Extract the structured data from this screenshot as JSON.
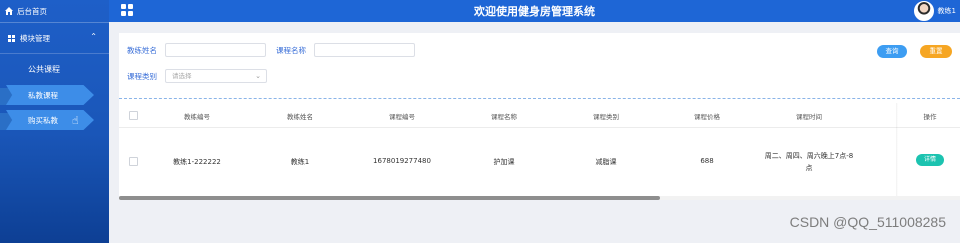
{
  "sidebar": {
    "home_label": "后台首页",
    "group_label": "模块管理",
    "items": [
      {
        "label": "公共课程"
      },
      {
        "label": "私教课程"
      },
      {
        "label": "购买私教"
      }
    ]
  },
  "header": {
    "title": "欢迎使用健身房管理系统",
    "username": "教练1"
  },
  "search": {
    "coach_name_label": "教练姓名",
    "course_name_label": "课程名称",
    "course_type_label": "课程类别",
    "course_type_placeholder": "请选择",
    "search_button": "查询",
    "reset_button": "重置"
  },
  "table": {
    "columns": [
      "教练编号",
      "教练姓名",
      "课程编号",
      "课程名称",
      "课程类别",
      "课程价格",
      "课程时间",
      "操作"
    ],
    "rows": [
      {
        "coach_id": "教练1-222222",
        "coach_name": "教练1",
        "course_id": "1678019277480",
        "course_name": "护加课",
        "course_type": "减脂课",
        "price": "688",
        "time_line1": "周二、周四、周六晚上7点-8",
        "time_line2": "点",
        "action": "详情"
      }
    ]
  },
  "watermark": "CSDN @QQ_511008285"
}
